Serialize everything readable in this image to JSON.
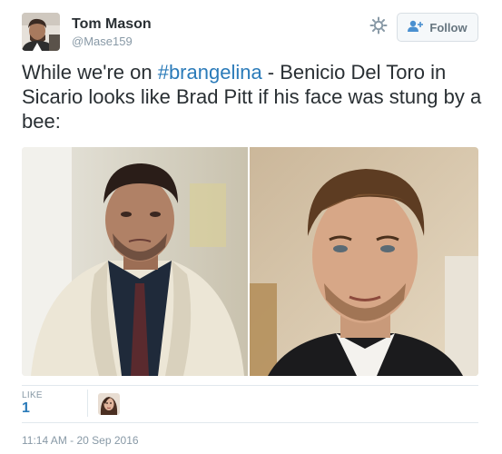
{
  "author": {
    "name": "Tom Mason",
    "handle": "@Mase159"
  },
  "actions": {
    "follow_label": "Follow",
    "settings_icon": "gear-icon",
    "follow_icon": "person-plus-icon"
  },
  "tweet": {
    "text_before": "While we're on ",
    "hashtag": "#brangelina",
    "text_after": " - Benicio Del Toro in Sicario looks like Brad Pitt if his face was stung by a bee:"
  },
  "stats": {
    "like_label": "LIKE",
    "like_count": "1"
  },
  "meta": {
    "timestamp": "11:14 AM - 20 Sep 2016"
  },
  "colors": {
    "link": "#2b7bb9",
    "text": "#292f33",
    "muted": "#8899a6"
  }
}
